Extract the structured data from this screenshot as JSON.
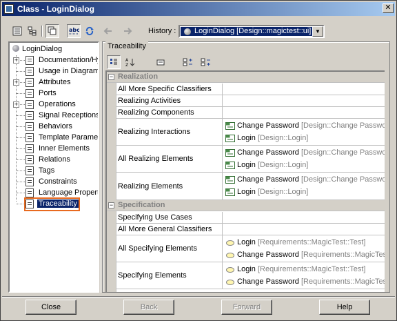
{
  "window": {
    "title": "Class - LoginDialog",
    "close_glyph": "✕"
  },
  "toolbar": {
    "history_label": "History :",
    "history_value": "LoginDialog [Design::magictest::ui]",
    "icons": [
      "tree-view-icon",
      "hierarchy-icon",
      "copy-icon",
      "spellcheck-icon",
      "refresh-icon",
      "back-arrow-icon",
      "forward-arrow-icon"
    ]
  },
  "tree": {
    "root": "LoginDialog",
    "items": [
      {
        "label": "Documentation/Hy",
        "expandable": true
      },
      {
        "label": "Usage in Diagrams",
        "expandable": false
      },
      {
        "label": "Attributes",
        "expandable": true
      },
      {
        "label": "Ports",
        "expandable": false
      },
      {
        "label": "Operations",
        "expandable": true
      },
      {
        "label": "Signal Receptions",
        "expandable": false
      },
      {
        "label": "Behaviors",
        "expandable": false
      },
      {
        "label": "Template Paramet",
        "expandable": false
      },
      {
        "label": "Inner Elements",
        "expandable": false
      },
      {
        "label": "Relations",
        "expandable": false
      },
      {
        "label": "Tags",
        "expandable": false
      },
      {
        "label": "Constraints",
        "expandable": false
      },
      {
        "label": "Language Properti",
        "expandable": false
      },
      {
        "label": "Traceability",
        "expandable": false,
        "selected": true
      }
    ]
  },
  "panel": {
    "title": "Traceability",
    "icons": [
      "categorized-icon",
      "sort-alpha-icon",
      "filter-icon",
      "expand-all-icon",
      "collapse-all-icon"
    ]
  },
  "table": {
    "realization": {
      "title": "Realization",
      "rows": {
        "all_more_specific": "All More Specific Classifiers",
        "realizing_activities": "Realizing Activities",
        "realizing_components": "Realizing Components",
        "realizing_interactions": {
          "name": "Realizing Interactions",
          "values": [
            {
              "name": "Change Password",
              "qualifier": "[Design::Change Passwor"
            },
            {
              "name": "Login",
              "qualifier": "[Design::Login]"
            }
          ]
        },
        "all_realizing_elements": {
          "name": "All Realizing Elements",
          "values": [
            {
              "name": "Change Password",
              "qualifier": "[Design::Change Passwor"
            },
            {
              "name": "Login",
              "qualifier": "[Design::Login]"
            }
          ]
        },
        "realizing_elements": {
          "name": "Realizing Elements",
          "values": [
            {
              "name": "Change Password",
              "qualifier": "[Design::Change Passwor"
            },
            {
              "name": "Login",
              "qualifier": "[Design::Login]"
            }
          ]
        }
      }
    },
    "specification": {
      "title": "Specification",
      "rows": {
        "specifying_use_cases": "Specifying Use Cases",
        "all_more_general": "All More General Classifiers",
        "all_specifying_elements": {
          "name": "All Specifying Elements",
          "values": [
            {
              "name": "Login",
              "qualifier": "[Requirements::MagicTest::Test]"
            },
            {
              "name": "Change Password",
              "qualifier": "[Requirements::MagicTes"
            }
          ]
        },
        "specifying_elements": {
          "name": "Specifying Elements",
          "values": [
            {
              "name": "Login",
              "qualifier": "[Requirements::MagicTest::Test]"
            },
            {
              "name": "Change Password",
              "qualifier": "[Requirements::MagicTes"
            }
          ]
        }
      }
    }
  },
  "buttons": {
    "close": "Close",
    "back": "Back",
    "forward": "Forward",
    "help": "Help"
  },
  "colors": {
    "selection": "#0a246a",
    "selection_frame": "#e86a1f",
    "window_bg": "#d4d0c8"
  }
}
